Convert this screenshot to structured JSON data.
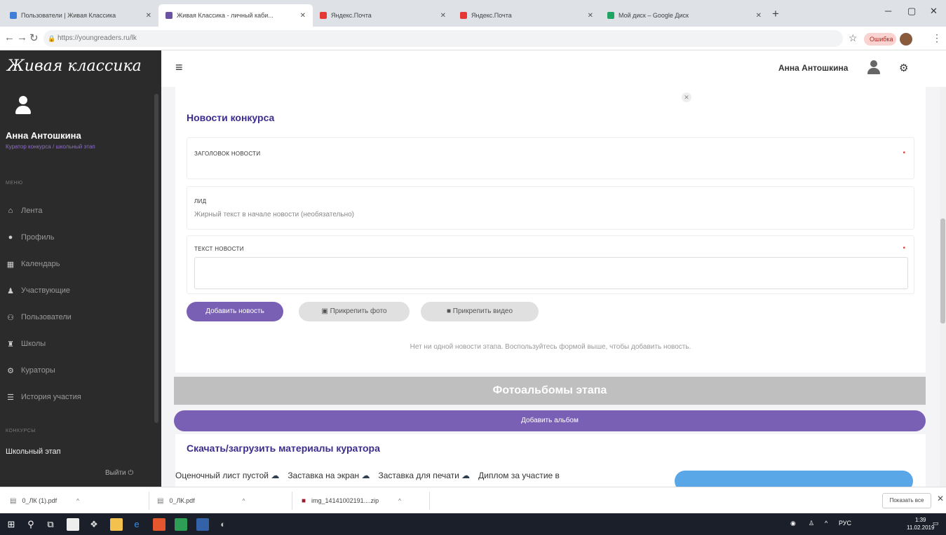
{
  "browser": {
    "tabs": [
      {
        "title": "Пользователи | Живая Классика",
        "active": false,
        "color": "#3f7fd8"
      },
      {
        "title": "Живая Классика - личный каби...",
        "active": true,
        "color": "#6b52a3"
      },
      {
        "title": "Яндекс.Почта",
        "active": false,
        "color": "#e53935"
      },
      {
        "title": "Яндекс.Почта",
        "active": false,
        "color": "#e53935"
      },
      {
        "title": "Мой диск – Google Диск",
        "active": false,
        "color": "#1fa463"
      }
    ],
    "new_tab": "+",
    "url": "https://youngreaders.ru/lk",
    "profile_label": "Ошибка"
  },
  "sidebar": {
    "logo": "Живая классика",
    "user_name": "Анна Антошкина",
    "user_role": "Куратор конкурса / школьный этап",
    "menu_heading": "МЕНЮ",
    "items": [
      {
        "label": "Лента",
        "icon": "home-icon",
        "glyph": "⌂"
      },
      {
        "label": "Профиль",
        "icon": "user-icon",
        "glyph": "●"
      },
      {
        "label": "Календарь",
        "icon": "calendar-icon",
        "glyph": "▦"
      },
      {
        "label": "Участвующие",
        "icon": "users-icon",
        "glyph": "♟"
      },
      {
        "label": "Пользователи",
        "icon": "group-icon",
        "glyph": "⚇"
      },
      {
        "label": "Школы",
        "icon": "school-icon",
        "glyph": "♜"
      },
      {
        "label": "Кураторы",
        "icon": "curators-icon",
        "glyph": "⚙"
      },
      {
        "label": "История участия",
        "icon": "list-icon",
        "glyph": "☰"
      }
    ],
    "contests_heading": "КОНКУРСЫ",
    "stage": "Школьный этап",
    "logout": "Выйти"
  },
  "header": {
    "user_name": "Анна Антошкина"
  },
  "news": {
    "title": "Новости конкурса",
    "headline_label": "ЗАГОЛОВОК НОВОСТИ",
    "lead_label": "ЛИД",
    "lead_placeholder": "Жирный текст в начале новости (необязательно)",
    "body_label": "ТЕКСТ НОВОСТИ",
    "add_button": "Добавить новость",
    "photo_button": "Прикрепить фото",
    "video_button": "Прикрепить видео",
    "empty": "Нет ни одной новости этапа. Воспользуйтесь формой выше, чтобы добавить новость."
  },
  "albums": {
    "title": "Фотоальбомы этапа",
    "add_button": "Добавить альбом"
  },
  "materials": {
    "title": "Скачать/загрузить материалы куратора",
    "links": [
      "Оценочный лист пустой",
      "Заставка на экран",
      "Заставка для печати",
      "Диплом за участие в"
    ]
  },
  "downloads": {
    "items": [
      "0_ЛК (1).pdf",
      "0_ЛК.pdf",
      "img_14141002191....zip"
    ],
    "show_all": "Показать все"
  },
  "taskbar": {
    "lang": "РУС",
    "time": "1:39",
    "date": "11.02.2019"
  }
}
